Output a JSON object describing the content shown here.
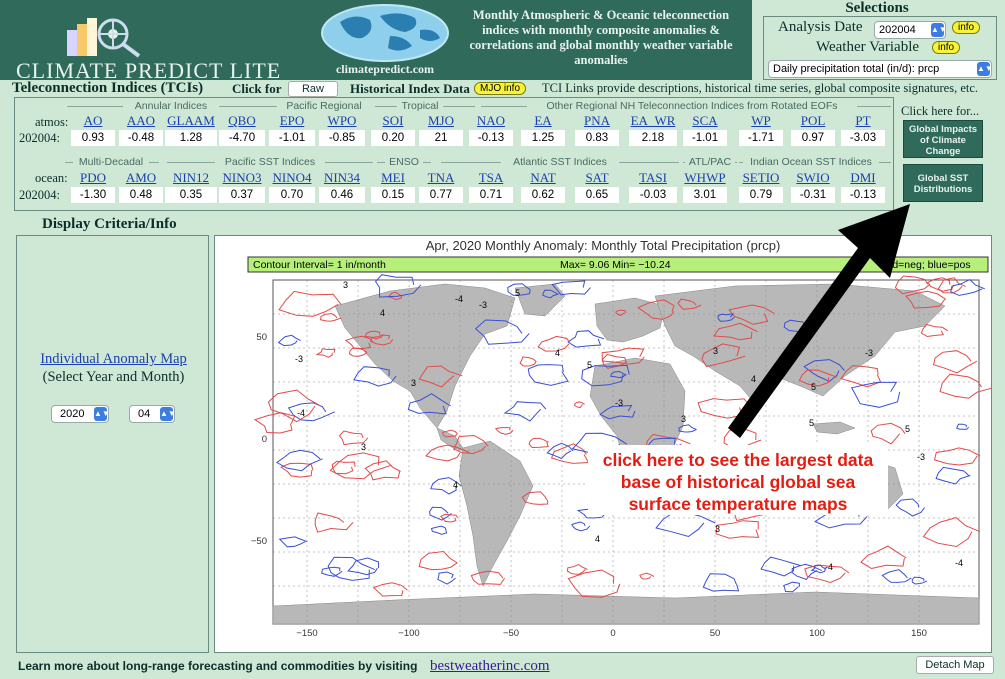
{
  "header": {
    "logo_text": "CLIMATE PREDICT LITE",
    "globe_caption": "climatepredict.com",
    "description": "Monthly Atmospheric & Oceanic teleconnection indices with monthly composite anomalies & correlations and global monthly weather variable anomalies"
  },
  "selections": {
    "title": "Selections",
    "analysis_date_label": "Analysis Date",
    "analysis_date_value": "202004",
    "weather_variable_label": "Weather Variable",
    "variable_value": "Daily precipitation total (in/d): prcp",
    "info_label": "info"
  },
  "tci": {
    "title": "Teleconnection Indices (TCIs)",
    "click_for": "Click for",
    "raw_button": "Raw",
    "historical_label": "Historical Index Data",
    "mjo_info": "MJO info",
    "links_text": "TCI Links provide descriptions, historical time series, global composite signatures, etc.",
    "atmos_label": "atmos:",
    "ocean_label": "ocean:",
    "date_label": "202004:",
    "atmos_groups": [
      "Annular Indices",
      "Pacific Regional",
      "Tropical",
      "Other Regional NH Teleconnection Indices from Rotated EOFs"
    ],
    "ocean_groups": [
      "Multi-Decadal",
      "Pacific SST Indices",
      "ENSO",
      "Atlantic SST Indices",
      "ATL/PAC",
      "Indian Ocean SST Indices"
    ],
    "atmos": [
      {
        "name": "AO",
        "value": "0.93"
      },
      {
        "name": "AAO",
        "value": "-0.48"
      },
      {
        "name": "GLAAM",
        "value": "1.28"
      },
      {
        "name": "QBO",
        "value": "-4.70"
      },
      {
        "name": "EPO",
        "value": "-1.01"
      },
      {
        "name": "WPO",
        "value": "-0.85"
      },
      {
        "name": "SOI",
        "value": "0.20"
      },
      {
        "name": "MJO",
        "value": "21"
      },
      {
        "name": "NAO",
        "value": "-0.13"
      },
      {
        "name": "EA",
        "value": "1.25"
      },
      {
        "name": "PNA",
        "value": "0.83"
      },
      {
        "name": "EA_WR",
        "value": "2.18"
      },
      {
        "name": "SCA",
        "value": "-1.01"
      },
      {
        "name": "WP",
        "value": "-1.71"
      },
      {
        "name": "POL",
        "value": "0.97"
      },
      {
        "name": "PT",
        "value": "-3.03"
      }
    ],
    "ocean": [
      {
        "name": "PDO",
        "value": "-1.30"
      },
      {
        "name": "AMO",
        "value": "0.48"
      },
      {
        "name": "NIN12",
        "value": "0.35"
      },
      {
        "name": "NINO3",
        "value": "0.37"
      },
      {
        "name": "NINO4",
        "value": "0.70"
      },
      {
        "name": "NIN34",
        "value": "0.46"
      },
      {
        "name": "MEI",
        "value": "0.15"
      },
      {
        "name": "TNA",
        "value": "0.77"
      },
      {
        "name": "TSA",
        "value": "0.71"
      },
      {
        "name": "NAT",
        "value": "0.62"
      },
      {
        "name": "SAT",
        "value": "0.65"
      },
      {
        "name": "TASI",
        "value": "-0.03"
      },
      {
        "name": "WHWP",
        "value": "3.01"
      },
      {
        "name": "SETIO",
        "value": "0.79"
      },
      {
        "name": "SWIO",
        "value": "-0.31"
      },
      {
        "name": "DMI",
        "value": "-0.13"
      }
    ],
    "click_here": "Click here for...",
    "btn_impacts": "Global Impacts of Climate Change",
    "btn_sst": "Global SST Distributions"
  },
  "display": {
    "title": "Display Criteria/Info",
    "link": "Individual Anomaly Map",
    "sub": "(Select Year and Month)",
    "year": "2020",
    "month": "04"
  },
  "map": {
    "title": "Apr, 2020   Monthly Anomaly: Monthly Total Precipitation (prcp)",
    "contour_interval": "Contour Interval= 1 in/month",
    "maxmin": "Max= 9.06  Min= −10.24",
    "legend": "red=neg; blue=pos",
    "x_ticks": [
      "−150",
      "−100",
      "−50",
      "0",
      "50",
      "100",
      "150"
    ],
    "y_ticks": [
      "50",
      "0",
      "−50"
    ],
    "contour_labels": [
      "3",
      "4",
      "5",
      "-3",
      "-4"
    ]
  },
  "overlay": {
    "callout": "click here to see the largest data base of historical global sea surface temperature maps"
  },
  "footer": {
    "text": "Learn more about long-range forecasting and commodities by visiting",
    "link": "bestweatherinc.com",
    "detach": "Detach Map"
  },
  "colors": {
    "header_bg": "#2f6a5b",
    "page_bg": "#cfe8d6",
    "link_blue": "#1a3fb0",
    "callout_red": "#e41d12",
    "anomaly_neg": "#e24a4a",
    "anomaly_pos": "#3a4fd6"
  }
}
